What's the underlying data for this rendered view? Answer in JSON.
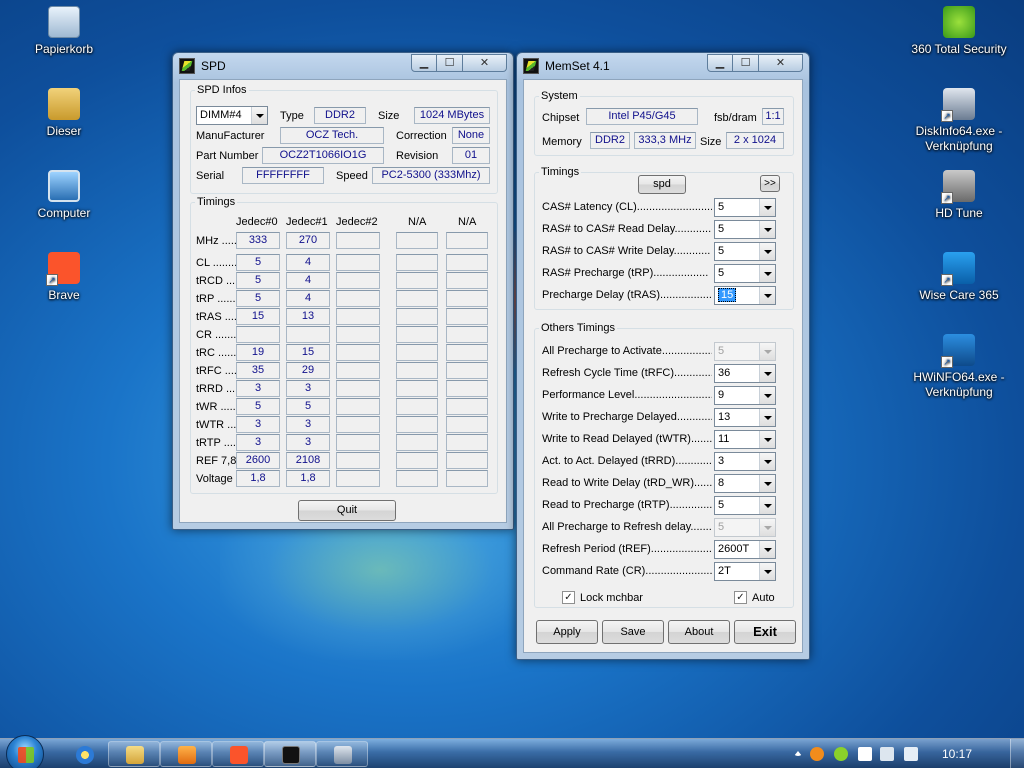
{
  "desktop": {
    "icons_left": [
      {
        "label": "Papierkorb",
        "icon": "recycle-bin-icon"
      },
      {
        "label": "Dieser",
        "icon": "user-folder-icon"
      },
      {
        "label": "Computer",
        "icon": "computer-icon"
      },
      {
        "label": "Brave",
        "icon": "brave-icon"
      }
    ],
    "icons_right": [
      {
        "label": "360 Total Security",
        "icon": "360-security-icon"
      },
      {
        "label": "DiskInfo64.exe -",
        "label2": "Verknüpfung",
        "icon": "diskinfo-icon"
      },
      {
        "label": "HD Tune",
        "icon": "hdtune-icon"
      },
      {
        "label": "Wise Care 365",
        "icon": "wisecare-icon"
      },
      {
        "label": "HWiNFO64.exe -",
        "label2": "Verknüpfung",
        "icon": "hwinfo-icon"
      }
    ]
  },
  "spd": {
    "title": "SPD",
    "infos": {
      "legend": "SPD Infos",
      "dimm": "DIMM#4",
      "type_label": "Type",
      "type": "DDR2",
      "size_label": "Size",
      "size": "1024 MBytes",
      "manufacturer_label": "ManuFacturer",
      "manufacturer": "OCZ Tech.",
      "correction_label": "Correction",
      "correction": "None",
      "part_label": "Part Number",
      "part": "OCZ2T1066IO1G",
      "revision_label": "Revision",
      "revision": "01",
      "serial_label": "Serial",
      "serial": "FFFFFFFF",
      "speed_label": "Speed",
      "speed": "PC2-5300 (333Mhz)"
    },
    "timings": {
      "legend": "Timings",
      "headers": [
        "Jedec#0",
        "Jedec#1",
        "Jedec#2",
        "N/A",
        "N/A"
      ],
      "rows": [
        {
          "label": "MHz .....",
          "v0": "333",
          "v1": "270"
        },
        {
          "label": "CL ........",
          "v0": "5",
          "v1": "4"
        },
        {
          "label": "tRCD .....",
          "v0": "5",
          "v1": "4"
        },
        {
          "label": "tRP ......",
          "v0": "5",
          "v1": "4"
        },
        {
          "label": "tRAS .....",
          "v0": "15",
          "v1": "13"
        },
        {
          "label": "CR ........",
          "v0": "",
          "v1": ""
        },
        {
          "label": "tRC .......",
          "v0": "19",
          "v1": "15"
        },
        {
          "label": "tRFC .....",
          "v0": "35",
          "v1": "29"
        },
        {
          "label": "tRRD .....",
          "v0": "3",
          "v1": "3"
        },
        {
          "label": "tWR .......",
          "v0": "5",
          "v1": "5"
        },
        {
          "label": "tWTR .....",
          "v0": "3",
          "v1": "3"
        },
        {
          "label": "tRTP .....",
          "v0": "3",
          "v1": "3"
        },
        {
          "label": "REF 7,8",
          "v0": "2600",
          "v1": "2108"
        },
        {
          "label": "Voltage",
          "v0": "1,8",
          "v1": "1,8"
        }
      ]
    },
    "quit": "Quit"
  },
  "memset": {
    "title": "MemSet 4.1",
    "system": {
      "legend": "System",
      "chipset_label": "Chipset",
      "chipset": "Intel P45/G45",
      "fsb_label": "fsb/dram",
      "fsb": "1:1",
      "memory_label": "Memory",
      "mem_type": "DDR2",
      "mem_speed": "333,3 MHz",
      "size_label": "Size",
      "size": "2 x 1024"
    },
    "timings": {
      "legend": "Timings",
      "spd_button": "spd",
      "more_button": ">>",
      "rows": [
        {
          "label": "CAS# Latency (CL)..........................",
          "value": "5"
        },
        {
          "label": "RAS# to CAS# Read Delay............",
          "value": "5"
        },
        {
          "label": "RAS# to CAS# Write Delay............",
          "value": "5"
        },
        {
          "label": "RAS# Precharge (tRP)..................",
          "value": "5"
        },
        {
          "label": "Precharge Delay  (tRAS)...................",
          "value": "15"
        }
      ]
    },
    "others": {
      "legend": "Others Timings",
      "rows": [
        {
          "label": "All Precharge to Activate....................",
          "value": "5"
        },
        {
          "label": "Refresh Cycle Time (tRFC)................",
          "value": "36"
        },
        {
          "label": "Performance Level.............................",
          "value": "9"
        },
        {
          "label": "Write to Precharge Delayed................",
          "value": "13"
        },
        {
          "label": "Write to Read Delayed (tWTR)...........",
          "value": "11"
        },
        {
          "label": "Act. to Act. Delayed (tRRD)...............",
          "value": "3"
        },
        {
          "label": "Read to Write Delay (tRD_WR)..........",
          "value": "8"
        },
        {
          "label": "Read to Precharge (tRTP)..................",
          "value": "5"
        },
        {
          "label": "All Precharge to Refresh delay.........",
          "value": "5"
        },
        {
          "label": "Refresh Period (tREF)........................",
          "value": "2600T"
        },
        {
          "label": "Command Rate (CR)............................",
          "value": "2T"
        }
      ],
      "lock_label": "Lock mchbar",
      "auto_label": "Auto"
    },
    "buttons": {
      "apply": "Apply",
      "save": "Save",
      "about": "About",
      "exit": "Exit"
    }
  },
  "taskbar": {
    "clock": "10:17"
  }
}
